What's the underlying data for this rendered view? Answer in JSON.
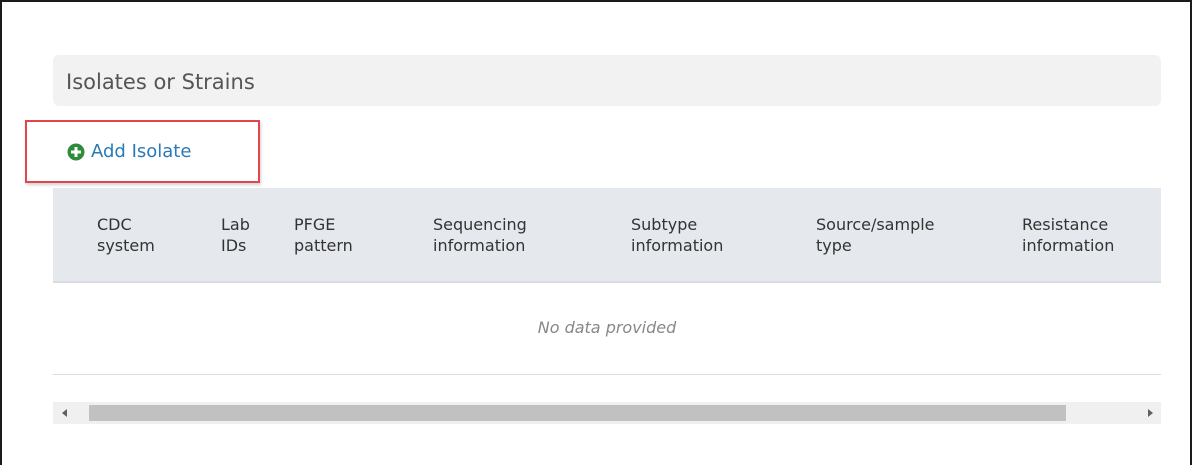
{
  "section": {
    "title": "Isolates or Strains"
  },
  "actions": {
    "add_isolate_label": "Add Isolate",
    "add_icon": "plus-circle-icon"
  },
  "table": {
    "columns": [
      {
        "line1": "CDC",
        "line2": "system"
      },
      {
        "line1": "Lab",
        "line2": "IDs"
      },
      {
        "line1": "PFGE",
        "line2": "pattern"
      },
      {
        "line1": "Sequencing",
        "line2": "information"
      },
      {
        "line1": "Subtype",
        "line2": "information"
      },
      {
        "line1": "Source/sample",
        "line2": "type"
      },
      {
        "line1": "Resistance",
        "line2": "information"
      }
    ],
    "empty_message": "No data provided"
  },
  "colors": {
    "link": "#2a7ab8",
    "add_icon": "#2e8b3a",
    "highlight": "#e0474c",
    "header_bg": "#e5e8ed"
  }
}
